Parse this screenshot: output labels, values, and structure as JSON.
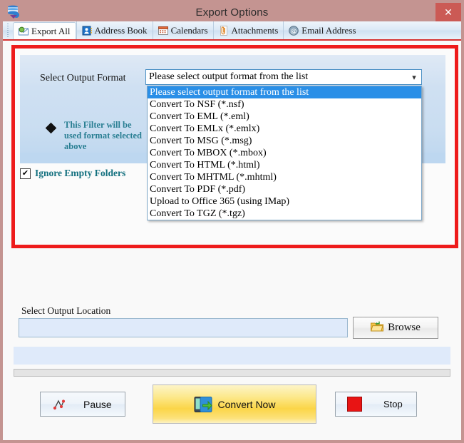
{
  "window": {
    "title": "Export Options",
    "icon": "database-export-icon",
    "close_label": "✕"
  },
  "tabs": [
    {
      "label": "Export All",
      "icon": "export-all-icon",
      "active": true
    },
    {
      "label": "Address Book",
      "icon": "address-book-icon",
      "active": false
    },
    {
      "label": "Calendars",
      "icon": "calendar-icon",
      "active": false
    },
    {
      "label": "Attachments",
      "icon": "attachment-icon",
      "active": false
    },
    {
      "label": "Email Address",
      "icon": "at-sign-icon",
      "active": false
    }
  ],
  "format_section": {
    "label": "Select Output Format",
    "selected_value": "Please select output format from the list",
    "arrow_icon": "chevron-down-icon",
    "dropdown_open": true,
    "options": [
      "Please select output format from the list",
      "Convert To NSF (*.nsf)",
      "Convert To EML (*.eml)",
      "Convert To EMLx (*.emlx)",
      "Convert To MSG (*.msg)",
      "Convert To MBOX (*.mbox)",
      "Convert To HTML (*.html)",
      "Convert To MHTML (*.mhtml)",
      "Convert To PDF (*.pdf)",
      "Upload to Office 365 (using IMap)",
      "Convert To TGZ (*.tgz)"
    ],
    "filter_note": "This Filter will be used format selected above",
    "bullet_icon": "diamond-bullet-icon"
  },
  "ignore_empty": {
    "label": "Ignore Empty Folders",
    "checked": true,
    "check_glyph": "✔"
  },
  "output_location": {
    "label": "Select Output Location",
    "value": "",
    "placeholder": "",
    "browse_label": "Browse",
    "browse_icon": "folder-open-icon"
  },
  "buttons": {
    "pause": {
      "label": "Pause",
      "icon": "pause-flag-icon"
    },
    "convert": {
      "label": "Convert Now",
      "icon": "convert-arrow-icon"
    },
    "stop": {
      "label": "Stop",
      "icon": "stop-square-icon"
    }
  },
  "colors": {
    "titlebar": "#c49491",
    "close": "#cb5a55",
    "highlight_border": "#ee1b1b",
    "accent_teal": "#13707f",
    "selection_blue": "#2a8fe7",
    "convert_yellow": "#fbd548"
  }
}
